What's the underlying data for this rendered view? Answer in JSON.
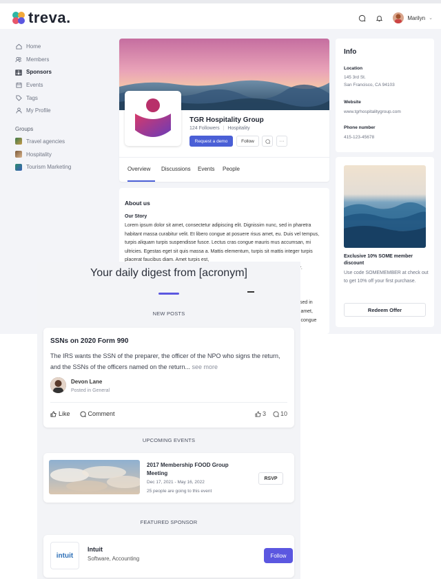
{
  "topbar": {
    "logo_text": "treva.",
    "user_name": "Marilyn"
  },
  "sidebar": {
    "items": [
      {
        "label": "Home",
        "icon": "home-icon"
      },
      {
        "label": "Members",
        "icon": "members-icon"
      },
      {
        "label": "Sponsors",
        "icon": "sponsors-icon"
      },
      {
        "label": "Events",
        "icon": "calendar-icon"
      },
      {
        "label": "Tags",
        "icon": "tag-icon"
      },
      {
        "label": "My Profile",
        "icon": "user-icon"
      }
    ],
    "groups_title": "Groups",
    "groups": [
      {
        "label": "Travel agencies",
        "color": "#3c7a4a"
      },
      {
        "label": "Hospitality",
        "color": "#7a5a3a"
      },
      {
        "label": "Tourism Marketing",
        "color": "#2b8a6e"
      }
    ]
  },
  "profile": {
    "company_name": "TGR Hospitality Group",
    "followers": "124 Followers",
    "category": "Hospitality",
    "demo_button": "Request a demo",
    "follow_button": "Follow",
    "more_button": "···",
    "tabs": [
      "Overview",
      "Discussions",
      "Events",
      "People"
    ]
  },
  "about": {
    "title": "About us",
    "story_title": "Our Story",
    "story_text": "Lorem ipsum dolor sit amet, consectetur adipiscing elit. Dignissim nunc, sed in pharetra habitant massa curabitur velit. Et libero congue at posuere risus amet, eu. Duis vel tempus, turpis aliquam turpis suspendisse fusce. Lectus cras congue mauris mus accumsan, mi ultricies. Egestas eget sit quis massa a. Mattis elementum, turpis sit mattis integer turpis placerat faucibus diam. Amet turpis est,",
    "trailing_1": "or.",
    "trailing_2": "sed in",
    "trailing_3": "s amet,",
    "trailing_4": "s congue"
  },
  "info": {
    "title": "Info",
    "location_label": "Location",
    "location_line1": "145 3rd St.",
    "location_line2": "San Francisco, CA 94103",
    "website_label": "Website",
    "website": "www.tgrhospitalitygroup.com",
    "phone_label": "Phone number",
    "phone": "415-123-45678"
  },
  "offer": {
    "title": "Exclusive 10% SOME member discount",
    "text": "Use code SOMEMEMBER at check out to get 10% off your first purchase.",
    "button": "Redeem Offer"
  },
  "digest": {
    "title": "Your daily digest from [acronym]",
    "new_posts_title": "NEW POSTS",
    "post": {
      "title": "SSNs on 2020 Form 990",
      "body": "The IRS wants the SSN of the preparer, the officer of the NPO who signs the return, and the SSNs of the officers named on the return...",
      "see_more": "see more",
      "author": "Devon Lane",
      "posted_in": "Posted in General",
      "like": "Like",
      "comment": "Comment",
      "like_count": "3",
      "comment_count": "10"
    },
    "events_title": "UPCOMING EVENTS",
    "event": {
      "title": "2017 Membership FOOD Group Meeting",
      "dates": "Dec 17, 2021 - May 16, 2022",
      "going": "25 people are going to this event",
      "rsvp": "RSVP"
    },
    "sponsor_title": "FEATURED SPONSOR",
    "sponsor": {
      "logo_text": "intuit",
      "name": "Intuit",
      "category": "Software, Accounting",
      "follow": "Follow"
    }
  },
  "colors": {
    "accent": "#4a5fd6",
    "digest_accent": "#5b57e0"
  }
}
